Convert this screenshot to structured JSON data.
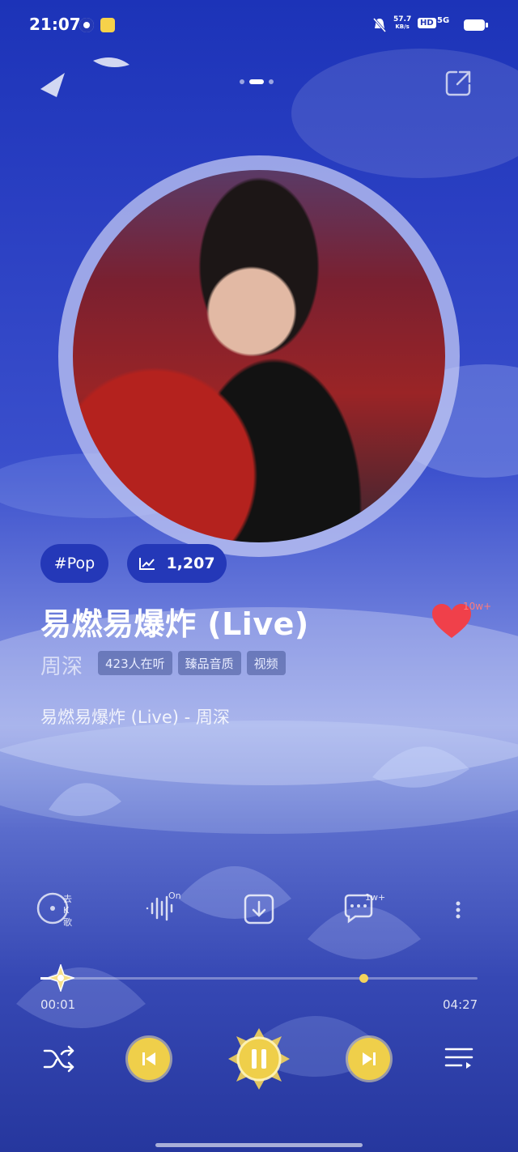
{
  "status_bar": {
    "time": "21:07",
    "net_speed_value": "57.7",
    "net_speed_unit": "KB/s",
    "hd_label": "HD",
    "signal_label": "5G"
  },
  "song": {
    "genre_tag": "#Pop",
    "rank_count": "1,207",
    "title": "易燃易爆炸 (Live)",
    "like_count": "10w+",
    "artist": "周深",
    "badges": [
      "423人在听",
      "臻品音质",
      "视频"
    ],
    "lyric_line": "易燃易爆炸 (Live) - 周深"
  },
  "actions": {
    "sing_label": "去K歌",
    "effect_label": "On",
    "comment_count": "1w+"
  },
  "progress": {
    "current_time": "00:01",
    "total_time": "04:27",
    "played_fraction": 0.004,
    "buffered_fraction": 0.74
  },
  "colors": {
    "accent_gold": "#efcf4a",
    "pill_blue": "#2438b8",
    "heart_red": "#f0404a"
  },
  "icons": {
    "share": "share-icon",
    "shuffle": "shuffle-icon",
    "prev": "skip-previous-icon",
    "pause": "pause-icon",
    "next": "skip-next-icon",
    "playlist": "playlist-icon"
  }
}
